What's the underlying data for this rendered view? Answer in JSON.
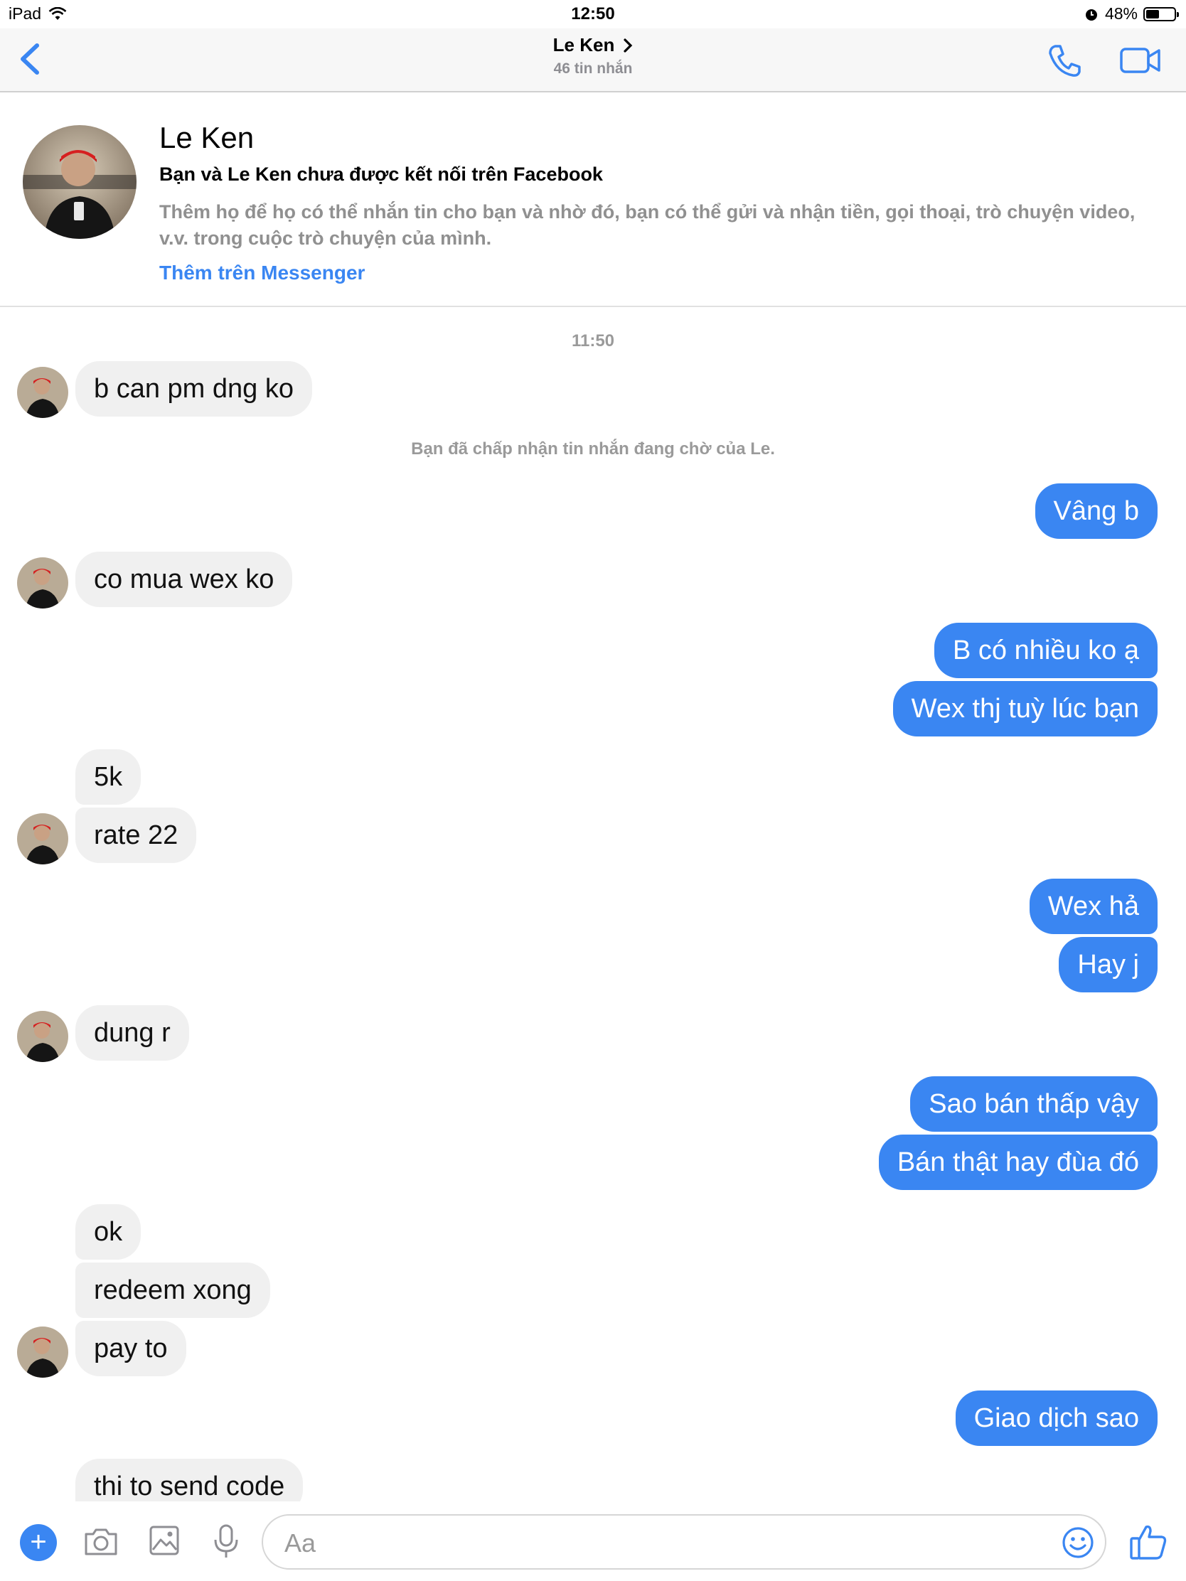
{
  "status_bar": {
    "device": "iPad",
    "time": "12:50",
    "battery": "48%",
    "battery_level": 0.48
  },
  "nav": {
    "name": "Le Ken",
    "subtitle": "46 tin nhắn"
  },
  "profile": {
    "name": "Le Ken",
    "connection": "Bạn và Le Ken chưa được kết nối trên Facebook",
    "description": "Thêm họ để họ có thể nhắn tin cho bạn và nhờ đó, bạn có thể gửi và nhận tiền, gọi thoại, trò chuyện video, v.v. trong cuộc trò chuyện của mình.",
    "add_link": "Thêm trên Messenger"
  },
  "chat": {
    "timestamp": "11:50",
    "system_message": "Bạn đã chấp nhận tin nhắn đang chờ của Le.",
    "messages": [
      {
        "from": "them",
        "text": "b can pm dng ko"
      },
      {
        "from": "me",
        "text": "Vâng b"
      },
      {
        "from": "them",
        "text": "co mua wex ko"
      },
      {
        "from": "me",
        "text": "B có nhiều ko ạ"
      },
      {
        "from": "me",
        "text": "Wex thj tuỳ lúc bạn"
      },
      {
        "from": "them",
        "text": "5k"
      },
      {
        "from": "them",
        "text": "rate 22"
      },
      {
        "from": "me",
        "text": "Wex hả"
      },
      {
        "from": "me",
        "text": "Hay j"
      },
      {
        "from": "them",
        "text": "dung r"
      },
      {
        "from": "me",
        "text": "Sao bán thấp vậy"
      },
      {
        "from": "me",
        "text": "Bán thật hay đùa đó"
      },
      {
        "from": "them",
        "text": "ok"
      },
      {
        "from": "them",
        "text": "redeem xong"
      },
      {
        "from": "them",
        "text": "pay to"
      },
      {
        "from": "me",
        "text": "Giao dịch sao"
      },
      {
        "from": "them",
        "text": "thi to send code"
      }
    ]
  },
  "composer": {
    "plus": "+",
    "placeholder": "Aa"
  },
  "colors": {
    "accent": "#3a86f2",
    "incoming_bubble": "#f0f0f0",
    "muted_text": "#909090"
  }
}
